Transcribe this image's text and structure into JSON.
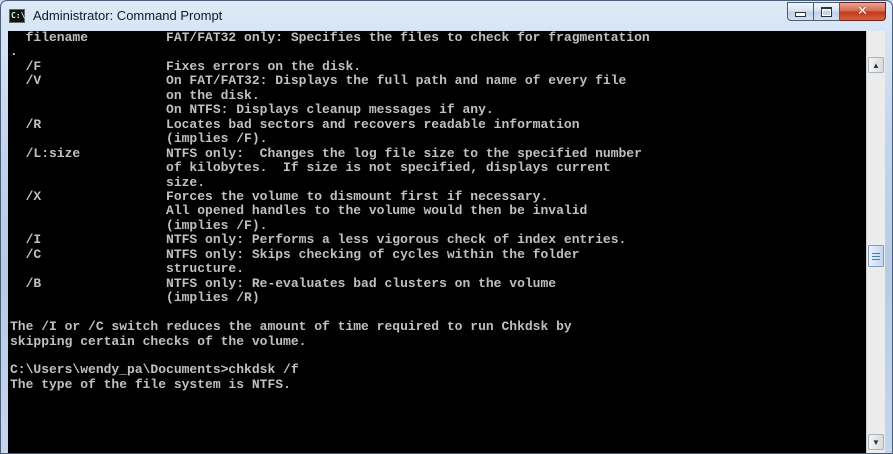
{
  "window": {
    "title": "Administrator: Command Prompt",
    "icon_text": "C:\\_",
    "icon_name": "console-icon"
  },
  "caption_buttons": {
    "minimize": "minimize-icon",
    "maximize": "maximize-icon",
    "close": "✕"
  },
  "console": {
    "lines": [
      "  filename          FAT/FAT32 only: Specifies the files to check for fragmentation",
      ".",
      "  /F                Fixes errors on the disk.",
      "  /V                On FAT/FAT32: Displays the full path and name of every file",
      "                    on the disk.",
      "                    On NTFS: Displays cleanup messages if any.",
      "  /R                Locates bad sectors and recovers readable information",
      "                    (implies /F).",
      "  /L:size           NTFS only:  Changes the log file size to the specified number",
      "                    of kilobytes.  If size is not specified, displays current",
      "                    size.",
      "  /X                Forces the volume to dismount first if necessary.",
      "                    All opened handles to the volume would then be invalid",
      "                    (implies /F).",
      "  /I                NTFS only: Performs a less vigorous check of index entries.",
      "  /C                NTFS only: Skips checking of cycles within the folder",
      "                    structure.",
      "  /B                NTFS only: Re-evaluates bad clusters on the volume",
      "                    (implies /R)",
      "",
      "The /I or /C switch reduces the amount of time required to run Chkdsk by",
      "skipping certain checks of the volume.",
      "",
      "C:\\Users\\wendy_pa\\Documents>chkdsk /f",
      "The type of the file system is NTFS."
    ]
  },
  "scrollbar": {
    "up_arrow": "▲",
    "down_arrow": "▼",
    "scroll_position": 0.5
  }
}
